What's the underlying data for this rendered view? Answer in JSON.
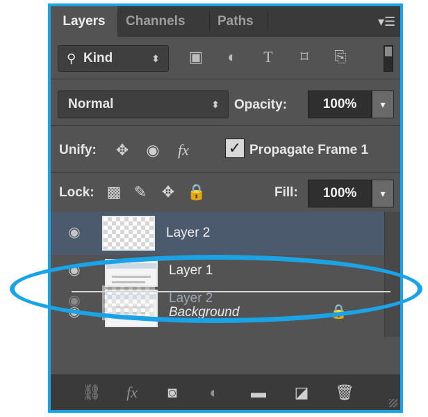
{
  "tabs": [
    {
      "label": "Layers",
      "active": true
    },
    {
      "label": "Channels",
      "active": false
    },
    {
      "label": "Paths",
      "active": false
    }
  ],
  "panel_menu_icon": "panel-menu-icon",
  "filter": {
    "kind_label": "Kind",
    "search_icon": "search-icon",
    "icons": [
      "image-filter-icon",
      "adjustment-filter-icon",
      "type-filter-icon",
      "shape-filter-icon",
      "smart-object-filter-icon"
    ],
    "toggle_on": true
  },
  "blend": {
    "mode": "Normal",
    "opacity_label": "Opacity:",
    "opacity_value": "100%"
  },
  "unify": {
    "label": "Unify:",
    "icons": [
      "unify-position-icon",
      "unify-visibility-icon",
      "unify-style-icon"
    ],
    "propagate_label": "Propagate Frame 1",
    "propagate_checked": true,
    "check_glyph": "✓"
  },
  "lock": {
    "label": "Lock:",
    "icons": [
      "lock-transparent-pixels-icon",
      "lock-image-pixels-icon",
      "lock-position-icon",
      "lock-all-icon"
    ],
    "fill_label": "Fill:",
    "fill_value": "100%"
  },
  "layers": [
    {
      "name": "Layer 2",
      "selected": true,
      "visible": true,
      "thumb": "transparent"
    },
    {
      "name": "Layer 1",
      "selected": false,
      "visible": true,
      "thumb": "document"
    },
    {
      "name": "Layer 2",
      "selected": false,
      "visible": true,
      "thumb": "transparent",
      "dragging_ghost": true
    },
    {
      "name": "Background",
      "selected": false,
      "visible": true,
      "thumb": "document",
      "locked": true,
      "italic": true
    }
  ],
  "bottom_icons": [
    "link-layers-icon",
    "layer-style-icon",
    "layer-mask-icon",
    "adjustment-layer-icon",
    "new-group-icon",
    "new-layer-icon",
    "delete-layer-icon"
  ],
  "colors": {
    "panel": "#535353",
    "dark_bar": "#3a3a3a",
    "selection": "#4c5a6e",
    "highlight": "#1aa3e6"
  }
}
